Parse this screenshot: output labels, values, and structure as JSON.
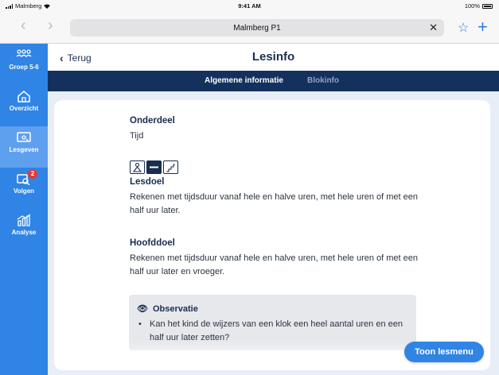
{
  "status": {
    "carrier": "Malmberg",
    "time": "9:41 AM",
    "battery": "100%"
  },
  "browser": {
    "url_title": "Malmberg P1",
    "clear_icon": "close-icon",
    "bookmark_icon": "star-icon",
    "new_tab_icon": "plus-icon"
  },
  "sidebar": {
    "items": [
      {
        "label": "Groep 5-6",
        "icon": "group-icon"
      },
      {
        "label": "Overzicht",
        "icon": "home-icon"
      },
      {
        "label": "Lesgeven",
        "icon": "teach-icon",
        "active": true
      },
      {
        "label": "Volgen",
        "icon": "follow-icon",
        "badge": "2"
      },
      {
        "label": "Analyse",
        "icon": "chart-icon"
      }
    ]
  },
  "header": {
    "back_label": "Terug",
    "title": "Lesinfo"
  },
  "tabs": [
    {
      "label": "Algemene informatie",
      "active": true
    },
    {
      "label": "Blokinfo",
      "active": false
    }
  ],
  "content": {
    "onderdeel_title": "Onderdeel",
    "onderdeel_value": "Tijd",
    "lesdoel_title": "Lesdoel",
    "lesdoel_text": "Rekenen met tijdsduur vanaf hele en halve uren, met hele uren of met een half uur later.",
    "hoofddoel_title": "Hoofddoel",
    "hoofddoel_text": "Rekenen met tijdsduur vanaf hele en halve uren, met hele uren of met een half uur later en vroeger.",
    "observatie_title": "Observatie",
    "observatie_bullet": "Kan het kind de wijzers van een klok een heel aantal uren en een half uur later zetten?"
  },
  "footer": {
    "toon_button": "Toon lesmenu"
  },
  "colors": {
    "sidebar": "#2f84e6",
    "sidebar_active": "#5fa0ee",
    "tabbar": "#14315e",
    "badge": "#e23a3a",
    "content_bg": "#e7eef8"
  }
}
